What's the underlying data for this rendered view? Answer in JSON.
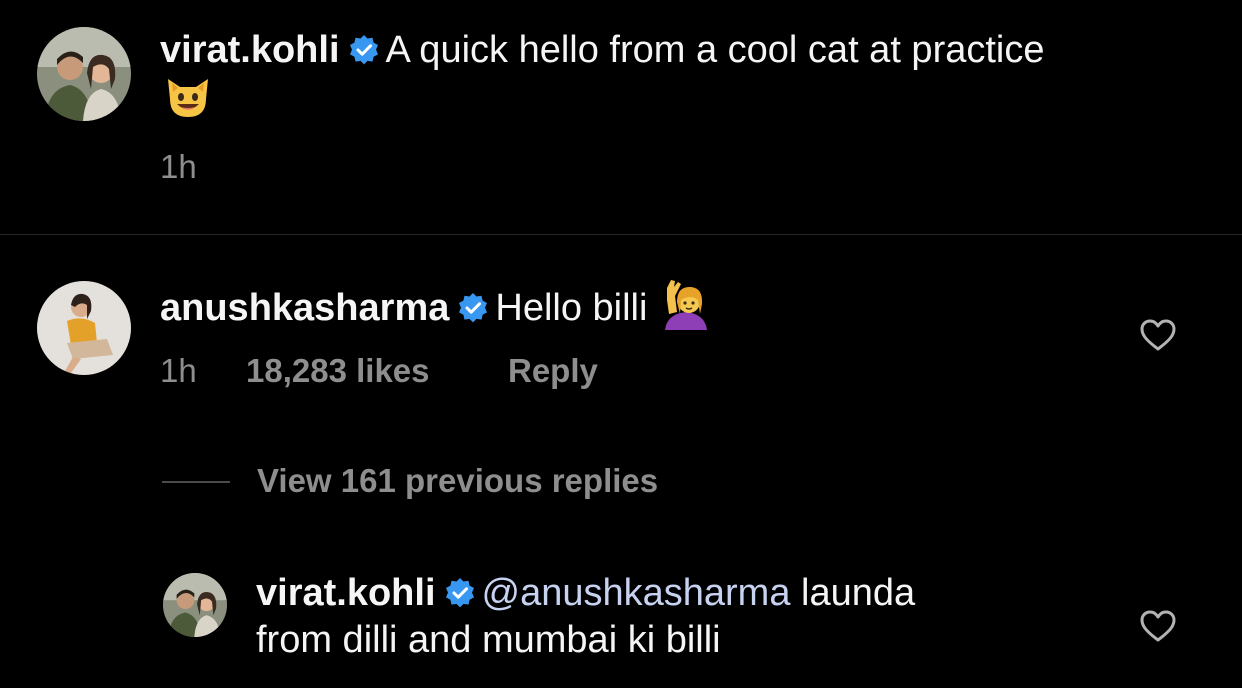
{
  "caption": {
    "username": "virat.kohli",
    "text": "A quick hello from a cool cat at practice",
    "emoji": "cat-smile-emoji",
    "time": "1h"
  },
  "comment": {
    "username": "anushkasharma",
    "text": "Hello billi",
    "emoji": "person-raising-hand-emoji",
    "time": "1h",
    "likes": "18,283 likes",
    "reply_label": "Reply"
  },
  "view_replies": "View 161 previous replies",
  "reply": {
    "username": "virat.kohli",
    "mention": "@anushkasharma",
    "text_line1": "launda",
    "text_line2": "from dilli and mumbai ki billi"
  },
  "colors": {
    "background": "#000000",
    "text": "#f5f5f5",
    "secondary": "#8e8e8e",
    "verified": "#3897f0",
    "mention": "#c7d2f0"
  }
}
